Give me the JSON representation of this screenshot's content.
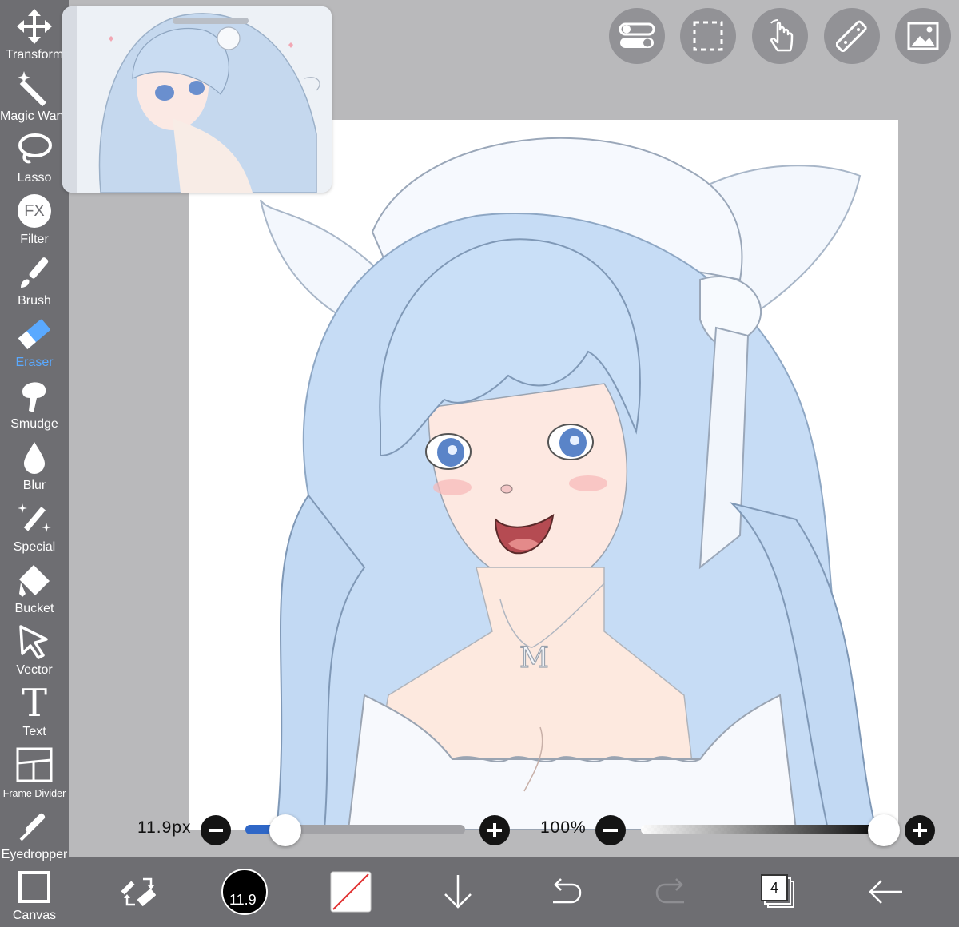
{
  "toolbar": {
    "tools": [
      {
        "label": "Transform",
        "icon": "move-arrows-icon",
        "active": false
      },
      {
        "label": "Magic Wand",
        "icon": "magic-wand-icon",
        "active": false
      },
      {
        "label": "Lasso",
        "icon": "lasso-icon",
        "active": false
      },
      {
        "label": "Filter",
        "icon": "fx-icon",
        "icon_text": "FX",
        "active": false
      },
      {
        "label": "Brush",
        "icon": "brush-icon",
        "active": false
      },
      {
        "label": "Eraser",
        "icon": "eraser-icon",
        "active": true
      },
      {
        "label": "Smudge",
        "icon": "smudge-icon",
        "active": false
      },
      {
        "label": "Blur",
        "icon": "blur-drop-icon",
        "active": false
      },
      {
        "label": "Special",
        "icon": "special-sparkle-pen-icon",
        "active": false
      },
      {
        "label": "Bucket",
        "icon": "bucket-icon",
        "active": false
      },
      {
        "label": "Vector",
        "icon": "vector-arrow-icon",
        "active": false
      },
      {
        "label": "Text",
        "icon": "text-t-icon",
        "icon_text": "T",
        "active": false
      },
      {
        "label": "Frame Divider",
        "icon": "frame-divider-icon",
        "active": false
      },
      {
        "label": "Eyedropper",
        "icon": "eyedropper-icon",
        "active": false
      },
      {
        "label": "Canvas",
        "icon": "canvas-square-icon",
        "active": false
      }
    ],
    "active_color": "#5aa9ff"
  },
  "top_buttons": [
    {
      "name": "toggle-icon"
    },
    {
      "name": "selection-icon"
    },
    {
      "name": "gesture-hand-icon"
    },
    {
      "name": "ruler-icon"
    },
    {
      "name": "image-icon"
    }
  ],
  "brush_size": {
    "value_text": "11.9px",
    "fraction": 0.18
  },
  "opacity": {
    "value_text": "100%",
    "fraction": 1.0
  },
  "bottom_bar": {
    "swap_icon": "swap-brush-eraser-icon",
    "brush_preview_text": "11.9",
    "color_icon": "color-swatch-icon",
    "download_icon": "arrow-down-icon",
    "undo_icon": "undo-icon",
    "redo_icon": "redo-icon",
    "layers_count": "4",
    "back_icon": "back-arrow-icon"
  },
  "colors": {
    "toolbar_bg": "#6e6e72",
    "canvas_bg": "#b9b9bb",
    "hair_blue": "#c6dcf5",
    "slider_fill": "#2f67c7"
  }
}
